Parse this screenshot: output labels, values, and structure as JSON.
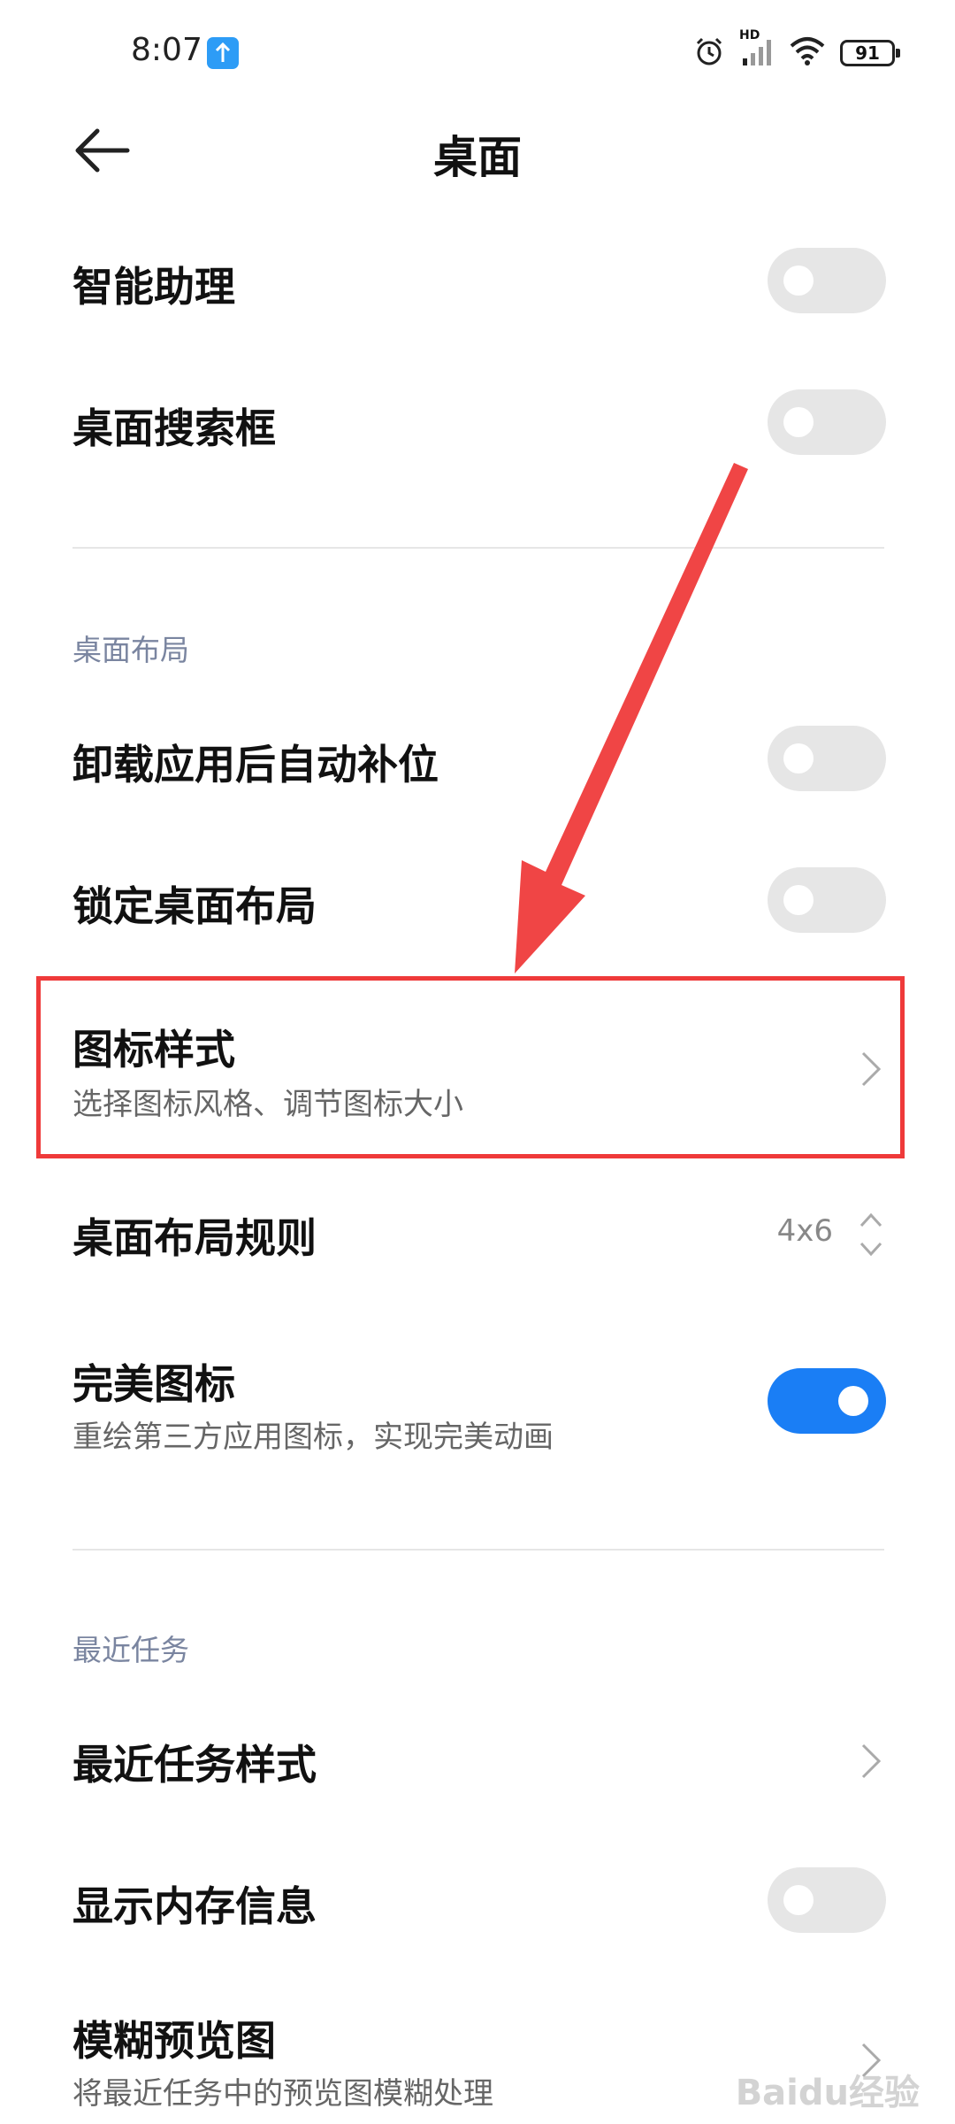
{
  "status_bar": {
    "time": "8:07",
    "hd_label": "HD",
    "battery": "91",
    "icons": [
      "upload-icon",
      "alarm-icon",
      "signal-icon",
      "wifi-icon",
      "battery-icon"
    ]
  },
  "header": {
    "title": "桌面",
    "back_icon": "back-arrow-icon"
  },
  "items": {
    "assistant": {
      "title": "智能助理",
      "enabled": false
    },
    "search_bar": {
      "title": "桌面搜索框",
      "enabled": false
    },
    "auto_fill": {
      "title": "卸载应用后自动补位",
      "enabled": false
    },
    "lock_layout": {
      "title": "锁定桌面布局",
      "enabled": false
    },
    "icon_style": {
      "title": "图标样式",
      "subtitle": "选择图标风格、调节图标大小"
    },
    "layout_rule": {
      "title": "桌面布局规则",
      "value": "4x6"
    },
    "perfect_icon": {
      "title": "完美图标",
      "subtitle": "重绘第三方应用图标，实现完美动画",
      "enabled": true
    },
    "recent_style": {
      "title": "最近任务样式"
    },
    "memory_info": {
      "title": "显示内存信息",
      "enabled": false
    },
    "blur_preview": {
      "title": "模糊预览图",
      "subtitle": "将最近任务中的预览图模糊处理"
    }
  },
  "sections": {
    "layout": "桌面布局",
    "recent": "最近任务"
  },
  "colors": {
    "accent": "#1a7ef5",
    "highlight_box": "#ef3a3a",
    "arrow": "#f04545"
  },
  "watermark": "Baidu经验"
}
